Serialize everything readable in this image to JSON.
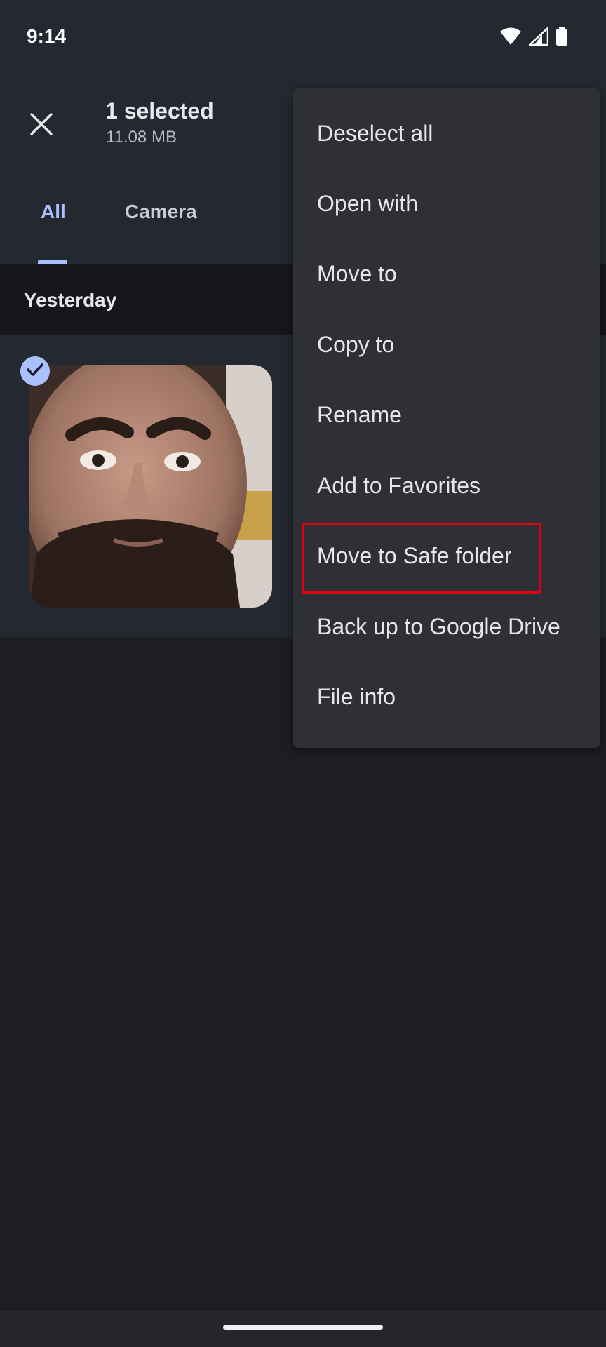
{
  "status_bar": {
    "time": "9:14",
    "icons": [
      "wifi-icon",
      "signal-icon",
      "battery-icon"
    ]
  },
  "header": {
    "title": "1 selected",
    "subtitle": "11.08 MB",
    "close_icon": "close-icon"
  },
  "tabs": [
    {
      "label": "All",
      "selected": true
    },
    {
      "label": "Camera",
      "selected": false
    }
  ],
  "section": {
    "label": "Yesterday"
  },
  "photo": {
    "selected": true,
    "check_icon": "check-icon"
  },
  "menu": {
    "items": [
      {
        "label": "Deselect all"
      },
      {
        "label": "Open with"
      },
      {
        "label": "Move to"
      },
      {
        "label": "Copy to"
      },
      {
        "label": "Rename"
      },
      {
        "label": "Add to Favorites"
      },
      {
        "label": "Move to Safe folder",
        "highlighted": true
      },
      {
        "label": "Back up to Google Drive"
      },
      {
        "label": "File info"
      }
    ]
  },
  "colors": {
    "accent": "#a9c1ff",
    "highlight": "#e00011",
    "background": "#1d1d22",
    "header_bg": "#242830",
    "menu_bg": "#2f3035"
  }
}
